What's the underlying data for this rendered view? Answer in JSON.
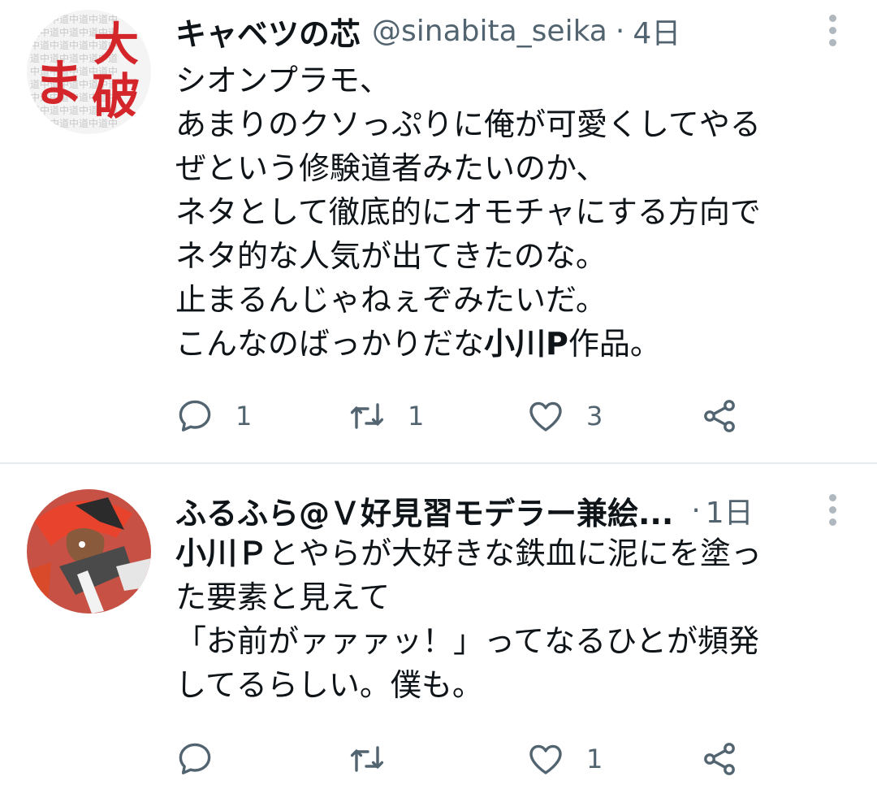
{
  "tweets": [
    {
      "name": "キャベツの芯",
      "handle": "@sinabita_seika",
      "separator": "·",
      "time": "4日",
      "avatar_text": {
        "big1": "大",
        "big2": "破",
        "small": "ま"
      },
      "lines": [
        {
          "text": "シオンプラモ、"
        },
        {
          "text": "あまりのクソっぷりに俺が可愛くしてやる"
        },
        {
          "text": "ぜという修験道者みたいのか、"
        },
        {
          "text": "ネタとして徹底的にオモチャにする方向で"
        },
        {
          "text": "ネタ的な人気が出てきたのな。"
        },
        {
          "text": "止まるんじゃねぇぞみたいだ。"
        },
        {
          "text": "こんなのばっかりだな",
          "bold": "小川P",
          "after": "作品。"
        }
      ],
      "reply_count": "1",
      "retweet_count": "1",
      "like_count": "3"
    },
    {
      "name": "ふるふら@Ｖ好見習モデラー兼絵...",
      "separator": "·",
      "time": "1日",
      "lines": [
        {
          "bold": "小川Ｐ",
          "after": "とやらが大好きな鉄血に泥にを塗っ"
        },
        {
          "text": "た要素と見えて"
        },
        {
          "text": "「お前がァァァッ！」ってなるひとが頻発"
        },
        {
          "text": "してるらしい。僕も。"
        }
      ],
      "reply_count": "",
      "retweet_count": "",
      "like_count": "1"
    }
  ],
  "colors": {
    "text": "#0f1419",
    "secondary": "#536471",
    "divider": "#e6ecf0",
    "avatar_red": "#d3252a"
  },
  "icons": {
    "reply": "reply-icon",
    "retweet": "retweet-icon",
    "like": "heart-icon",
    "share": "share-icon",
    "more": "more-vertical-icon"
  }
}
